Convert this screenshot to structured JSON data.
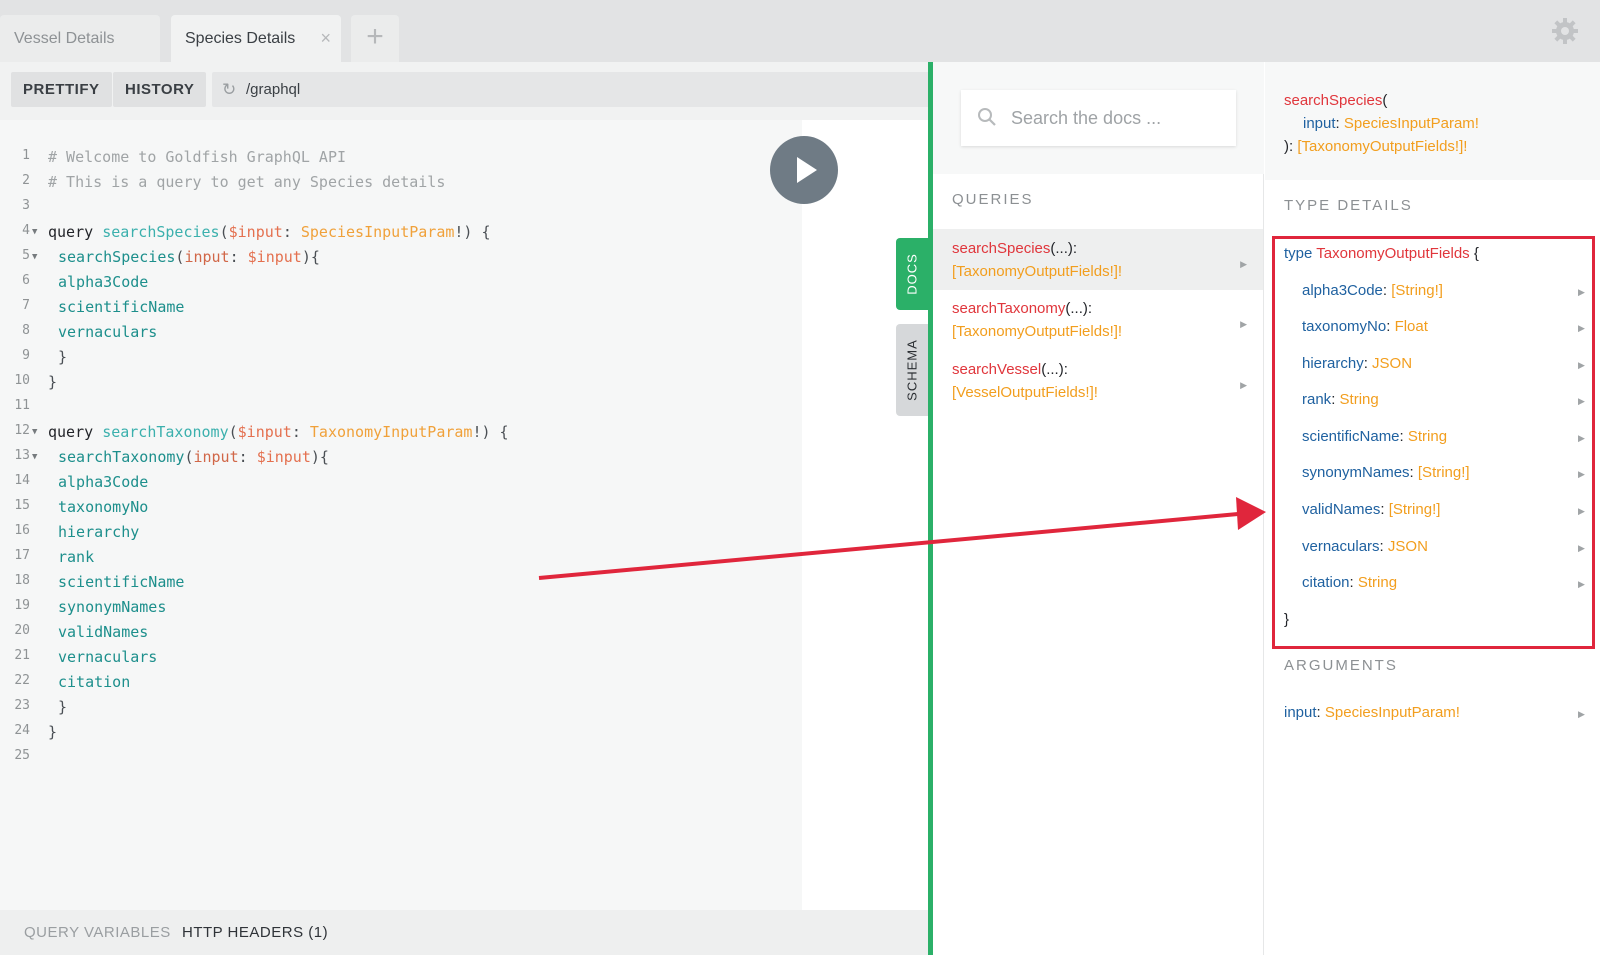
{
  "tabs": [
    {
      "label": "Vessel Details",
      "active": false
    },
    {
      "label": "Species Details",
      "active": true
    }
  ],
  "tab_close_glyph": "×",
  "tab_add_glyph": "+",
  "toolbar": {
    "prettify_label": "PRETTIFY",
    "history_label": "HISTORY",
    "url": "/graphql"
  },
  "editor": {
    "line_numbers": [
      "1",
      "2",
      "3",
      "4",
      "5",
      "6",
      "7",
      "8",
      "9",
      "10",
      "11",
      "12",
      "13",
      "14",
      "15",
      "16",
      "17",
      "18",
      "19",
      "20",
      "21",
      "22",
      "23",
      "24",
      "25"
    ],
    "comment_1": "# Welcome to Goldfish GraphQL API",
    "comment_2": "# This is a query to get any Species details",
    "query_kw": "query",
    "q1_name": "searchSpecies",
    "q1_var": "$input",
    "q1_type": "SpeciesInputParam",
    "q1_call": "searchSpecies",
    "q2_name": "searchTaxonomy",
    "q2_var": "$input",
    "q2_type": "TaxonomyInputParam",
    "q2_call": "searchTaxonomy",
    "arg_name": "input",
    "q1_fields": [
      "alpha3Code",
      "scientificName",
      "vernaculars"
    ],
    "q2_fields": [
      "alpha3Code",
      "taxonomyNo",
      "hierarchy",
      "rank",
      "scientificName",
      "synonymNames",
      "validNames",
      "vernaculars",
      "citation"
    ]
  },
  "bottom_bar": {
    "query_variables": "QUERY VARIABLES",
    "http_headers": "HTTP HEADERS (1)"
  },
  "side_tabs": {
    "docs": "DOCS",
    "schema": "SCHEMA"
  },
  "docs": {
    "search_placeholder": "Search the docs ...",
    "queries_title": "QUERIES",
    "queries": [
      {
        "name": "searchSpecies",
        "args": "(...):",
        "type": "[TaxonomyOutputFields!]!",
        "active": true
      },
      {
        "name": "searchTaxonomy",
        "args": "(...):",
        "type": "[TaxonomyOutputFields!]!",
        "active": false
      },
      {
        "name": "searchVessel",
        "args": "(...):",
        "type": "[VesselOutputFields!]!",
        "active": false
      }
    ]
  },
  "type_detail": {
    "sig_name": "searchSpecies",
    "sig_open": "(",
    "sig_arg": "input",
    "sig_arg_type": "SpeciesInputParam!",
    "sig_close": "):",
    "sig_return": "[TaxonomyOutputFields!]!",
    "type_details_title": "TYPE DETAILS",
    "type_kw": "type",
    "type_name": "TaxonomyOutputFields",
    "open_brace": "{",
    "close_brace": "}",
    "fields": [
      {
        "name": "alpha3Code",
        "type": "[String!]"
      },
      {
        "name": "taxonomyNo",
        "type": "Float"
      },
      {
        "name": "hierarchy",
        "type": "JSON"
      },
      {
        "name": "rank",
        "type": "String"
      },
      {
        "name": "scientificName",
        "type": "String"
      },
      {
        "name": "synonymNames",
        "type": "[String!]"
      },
      {
        "name": "validNames",
        "type": "[String!]"
      },
      {
        "name": "vernaculars",
        "type": "JSON"
      },
      {
        "name": "citation",
        "type": "String"
      }
    ],
    "arguments_title": "ARGUMENTS",
    "argument": {
      "name": "input",
      "type": "SpeciesInputParam!"
    }
  },
  "colors": {
    "accent_green": "#2bb068",
    "annotation_red": "#e0263c",
    "field_name_blue": "#1f61a0",
    "type_orange": "#f29e1e",
    "query_red": "#e0363c"
  },
  "icons": [
    "gear-icon",
    "reload-icon",
    "play-icon",
    "search-icon",
    "chevron-right-icon",
    "fold-arrow-icon",
    "close-icon",
    "plus-icon"
  ]
}
